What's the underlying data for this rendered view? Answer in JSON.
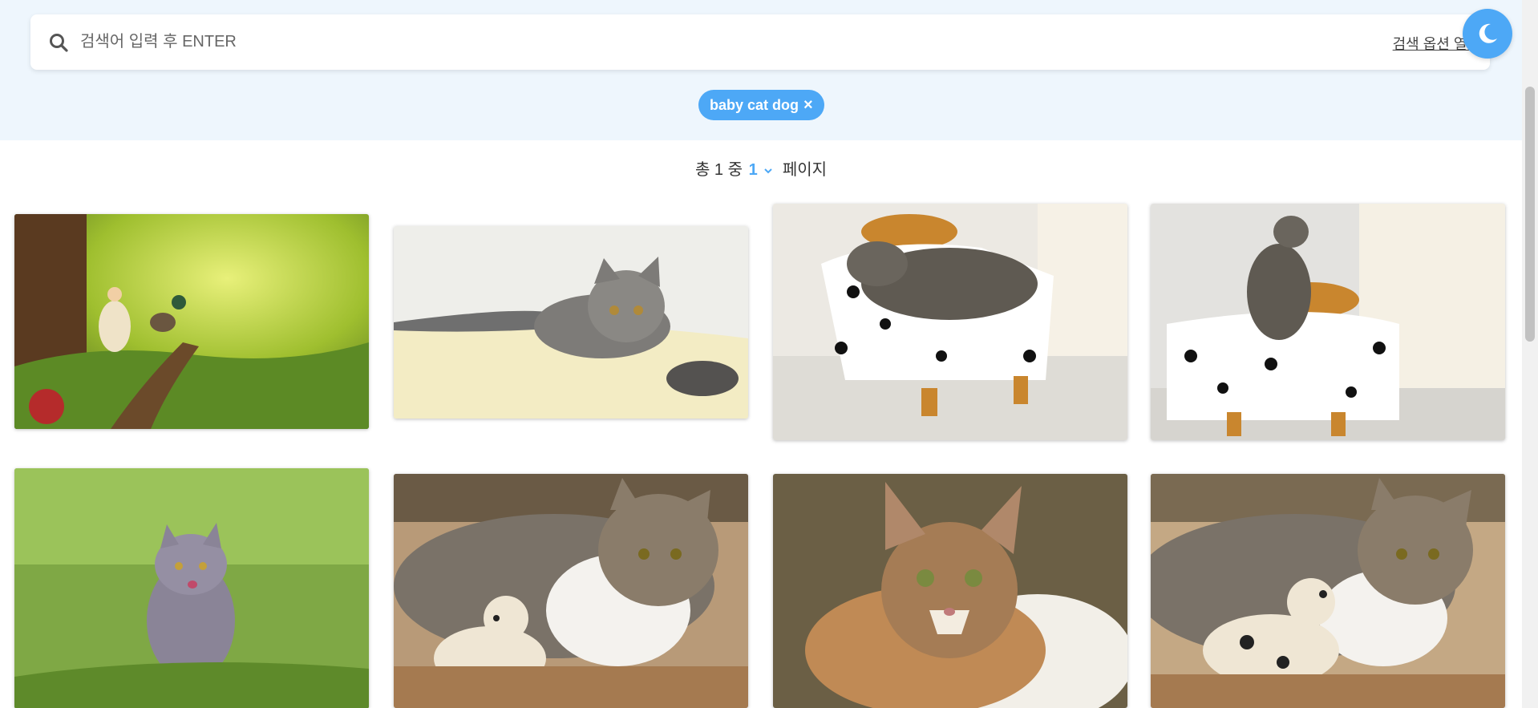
{
  "search": {
    "placeholder": "검색어 입력 후 ENTER",
    "value": "",
    "options_link": "검색 옵션 열기",
    "icon": "search-icon"
  },
  "theme_toggle": {
    "icon": "moon-icon"
  },
  "tags": [
    {
      "label": "baby cat dog",
      "close": "×"
    }
  ],
  "pagination": {
    "prefix": "총 1 중",
    "current": "1",
    "suffix": "페이지"
  },
  "gallery": [
    {
      "subject": "child-riding-dog-forest"
    },
    {
      "subject": "gray-kitten-lying-on-blanket"
    },
    {
      "subject": "tabby-cat-sleeping-on-dalmatian-sofa"
    },
    {
      "subject": "tabby-kitten-sitting-on-dalmatian-sofa"
    },
    {
      "subject": "gray-kitten-in-grass"
    },
    {
      "subject": "tabby-cat-with-plush-dog"
    },
    {
      "subject": "calico-cat-portrait"
    },
    {
      "subject": "tabby-cat-with-dalmatian-plush"
    }
  ],
  "colors": {
    "accent": "#4da8f6",
    "header_bg": "#eef6fd"
  }
}
